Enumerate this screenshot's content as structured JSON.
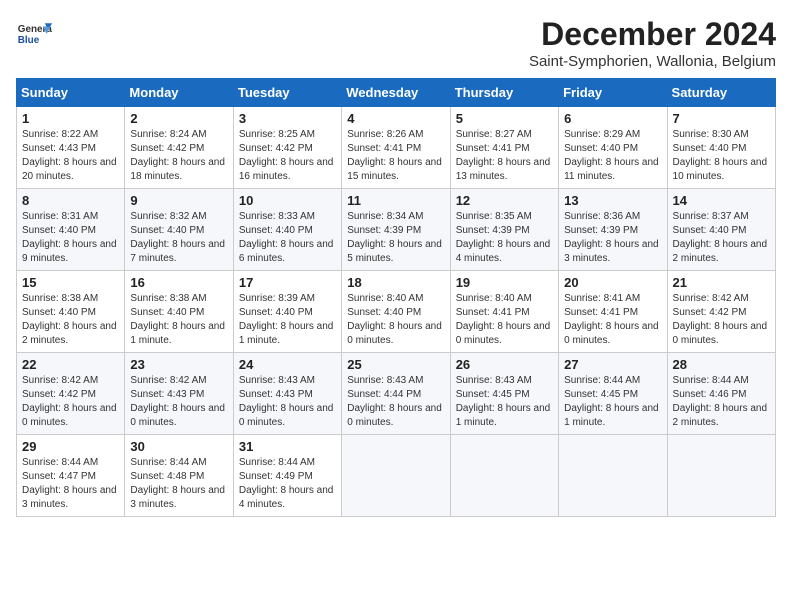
{
  "logo": {
    "general": "General",
    "blue": "Blue"
  },
  "title": "December 2024",
  "subtitle": "Saint-Symphorien, Wallonia, Belgium",
  "weekdays": [
    "Sunday",
    "Monday",
    "Tuesday",
    "Wednesday",
    "Thursday",
    "Friday",
    "Saturday"
  ],
  "weeks": [
    [
      {
        "day": "1",
        "rise": "8:22 AM",
        "set": "4:43 PM",
        "daylight": "8 hours and 20 minutes."
      },
      {
        "day": "2",
        "rise": "8:24 AM",
        "set": "4:42 PM",
        "daylight": "8 hours and 18 minutes."
      },
      {
        "day": "3",
        "rise": "8:25 AM",
        "set": "4:42 PM",
        "daylight": "8 hours and 16 minutes."
      },
      {
        "day": "4",
        "rise": "8:26 AM",
        "set": "4:41 PM",
        "daylight": "8 hours and 15 minutes."
      },
      {
        "day": "5",
        "rise": "8:27 AM",
        "set": "4:41 PM",
        "daylight": "8 hours and 13 minutes."
      },
      {
        "day": "6",
        "rise": "8:29 AM",
        "set": "4:40 PM",
        "daylight": "8 hours and 11 minutes."
      },
      {
        "day": "7",
        "rise": "8:30 AM",
        "set": "4:40 PM",
        "daylight": "8 hours and 10 minutes."
      }
    ],
    [
      {
        "day": "8",
        "rise": "8:31 AM",
        "set": "4:40 PM",
        "daylight": "8 hours and 9 minutes."
      },
      {
        "day": "9",
        "rise": "8:32 AM",
        "set": "4:40 PM",
        "daylight": "8 hours and 7 minutes."
      },
      {
        "day": "10",
        "rise": "8:33 AM",
        "set": "4:40 PM",
        "daylight": "8 hours and 6 minutes."
      },
      {
        "day": "11",
        "rise": "8:34 AM",
        "set": "4:39 PM",
        "daylight": "8 hours and 5 minutes."
      },
      {
        "day": "12",
        "rise": "8:35 AM",
        "set": "4:39 PM",
        "daylight": "8 hours and 4 minutes."
      },
      {
        "day": "13",
        "rise": "8:36 AM",
        "set": "4:39 PM",
        "daylight": "8 hours and 3 minutes."
      },
      {
        "day": "14",
        "rise": "8:37 AM",
        "set": "4:40 PM",
        "daylight": "8 hours and 2 minutes."
      }
    ],
    [
      {
        "day": "15",
        "rise": "8:38 AM",
        "set": "4:40 PM",
        "daylight": "8 hours and 2 minutes."
      },
      {
        "day": "16",
        "rise": "8:38 AM",
        "set": "4:40 PM",
        "daylight": "8 hours and 1 minute."
      },
      {
        "day": "17",
        "rise": "8:39 AM",
        "set": "4:40 PM",
        "daylight": "8 hours and 1 minute."
      },
      {
        "day": "18",
        "rise": "8:40 AM",
        "set": "4:40 PM",
        "daylight": "8 hours and 0 minutes."
      },
      {
        "day": "19",
        "rise": "8:40 AM",
        "set": "4:41 PM",
        "daylight": "8 hours and 0 minutes."
      },
      {
        "day": "20",
        "rise": "8:41 AM",
        "set": "4:41 PM",
        "daylight": "8 hours and 0 minutes."
      },
      {
        "day": "21",
        "rise": "8:42 AM",
        "set": "4:42 PM",
        "daylight": "8 hours and 0 minutes."
      }
    ],
    [
      {
        "day": "22",
        "rise": "8:42 AM",
        "set": "4:42 PM",
        "daylight": "8 hours and 0 minutes."
      },
      {
        "day": "23",
        "rise": "8:42 AM",
        "set": "4:43 PM",
        "daylight": "8 hours and 0 minutes."
      },
      {
        "day": "24",
        "rise": "8:43 AM",
        "set": "4:43 PM",
        "daylight": "8 hours and 0 minutes."
      },
      {
        "day": "25",
        "rise": "8:43 AM",
        "set": "4:44 PM",
        "daylight": "8 hours and 0 minutes."
      },
      {
        "day": "26",
        "rise": "8:43 AM",
        "set": "4:45 PM",
        "daylight": "8 hours and 1 minute."
      },
      {
        "day": "27",
        "rise": "8:44 AM",
        "set": "4:45 PM",
        "daylight": "8 hours and 1 minute."
      },
      {
        "day": "28",
        "rise": "8:44 AM",
        "set": "4:46 PM",
        "daylight": "8 hours and 2 minutes."
      }
    ],
    [
      {
        "day": "29",
        "rise": "8:44 AM",
        "set": "4:47 PM",
        "daylight": "8 hours and 3 minutes."
      },
      {
        "day": "30",
        "rise": "8:44 AM",
        "set": "4:48 PM",
        "daylight": "8 hours and 3 minutes."
      },
      {
        "day": "31",
        "rise": "8:44 AM",
        "set": "4:49 PM",
        "daylight": "8 hours and 4 minutes."
      },
      null,
      null,
      null,
      null
    ]
  ],
  "labels": {
    "sunrise": "Sunrise:",
    "sunset": "Sunset:",
    "daylight": "Daylight:"
  }
}
